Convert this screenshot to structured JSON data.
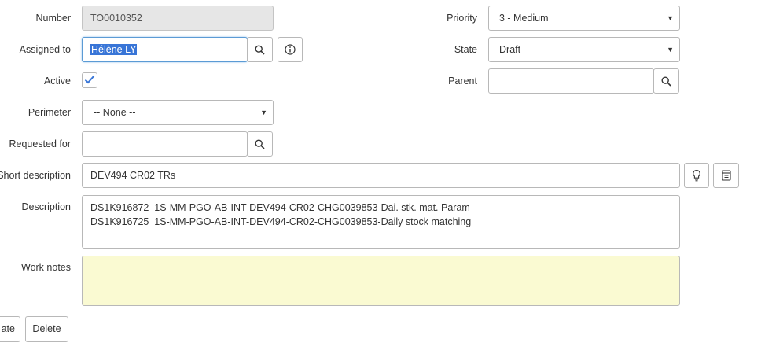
{
  "fields": {
    "number": {
      "label": "Number",
      "value": "TO0010352"
    },
    "assigned_to": {
      "label": "Assigned to",
      "value": "Hélène LY"
    },
    "active": {
      "label": "Active",
      "checked": true
    },
    "perimeter": {
      "label": "Perimeter",
      "value": "-- None --"
    },
    "requested_for": {
      "label": "Requested for",
      "value": ""
    },
    "short_description": {
      "label": "Short description",
      "value": "DEV494 CR02 TRs"
    },
    "description": {
      "label": "Description",
      "value": "DS1K916872  1S-MM-PGO-AB-INT-DEV494-CR02-CHG0039853-Dai. stk. mat. Param\nDS1K916725  1S-MM-PGO-AB-INT-DEV494-CR02-CHG0039853-Daily stock matching"
    },
    "work_notes": {
      "label": "Work notes",
      "value": ""
    },
    "priority": {
      "label": "Priority",
      "value": "3 - Medium"
    },
    "state": {
      "label": "State",
      "value": "Draft"
    },
    "parent": {
      "label": "Parent",
      "value": ""
    }
  },
  "buttons": {
    "update": "ate",
    "delete": "Delete"
  },
  "icons": {
    "search": "search-icon",
    "info": "info-icon",
    "lightbulb": "lightbulb-icon",
    "template": "template-icon",
    "checkmark": "checkmark-icon"
  },
  "colors": {
    "accent": "#3875d7",
    "work_notes_bg": "#fafad2",
    "readonly_bg": "#e6e6e6"
  }
}
